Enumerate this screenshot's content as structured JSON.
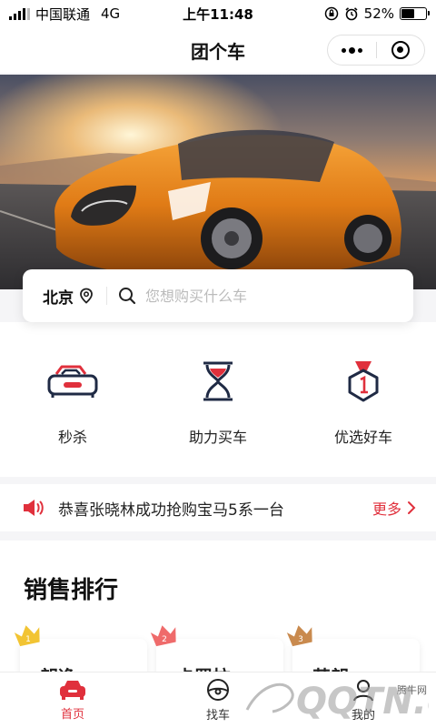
{
  "status_bar": {
    "carrier": "中国联通",
    "network": "4G",
    "time": "上午11:48",
    "battery": "52%",
    "battery_level": 0.52
  },
  "nav": {
    "title": "团个车"
  },
  "search": {
    "city": "北京",
    "placeholder": "您想购买什么车"
  },
  "features": [
    {
      "label": "秒杀",
      "icon": "car-icon"
    },
    {
      "label": "助力买车",
      "icon": "hourglass-icon"
    },
    {
      "label": "优选好车",
      "icon": "medal-icon"
    }
  ],
  "notice": {
    "text": "恭喜张晓林成功抢购宝马5系一台",
    "more_label": "更多"
  },
  "ranking": {
    "title": "销售排行",
    "cards": [
      {
        "rank": "1",
        "name": "朗逸",
        "crown_color": "#f2c433"
      },
      {
        "rank": "2",
        "name": "卡罗拉",
        "crown_color": "#ef6b6b"
      },
      {
        "rank": "3",
        "name": "英朗",
        "crown_color": "#c98a4e"
      }
    ]
  },
  "tabbar": {
    "items": [
      {
        "label": "首页",
        "active": true
      },
      {
        "label": "找车",
        "active": false
      },
      {
        "label": "我的",
        "active": false
      }
    ]
  },
  "watermark": {
    "text": "QQTN.com",
    "site": "腾牛网"
  },
  "colors": {
    "accent": "#e0303c",
    "navy": "#1f2a44"
  }
}
